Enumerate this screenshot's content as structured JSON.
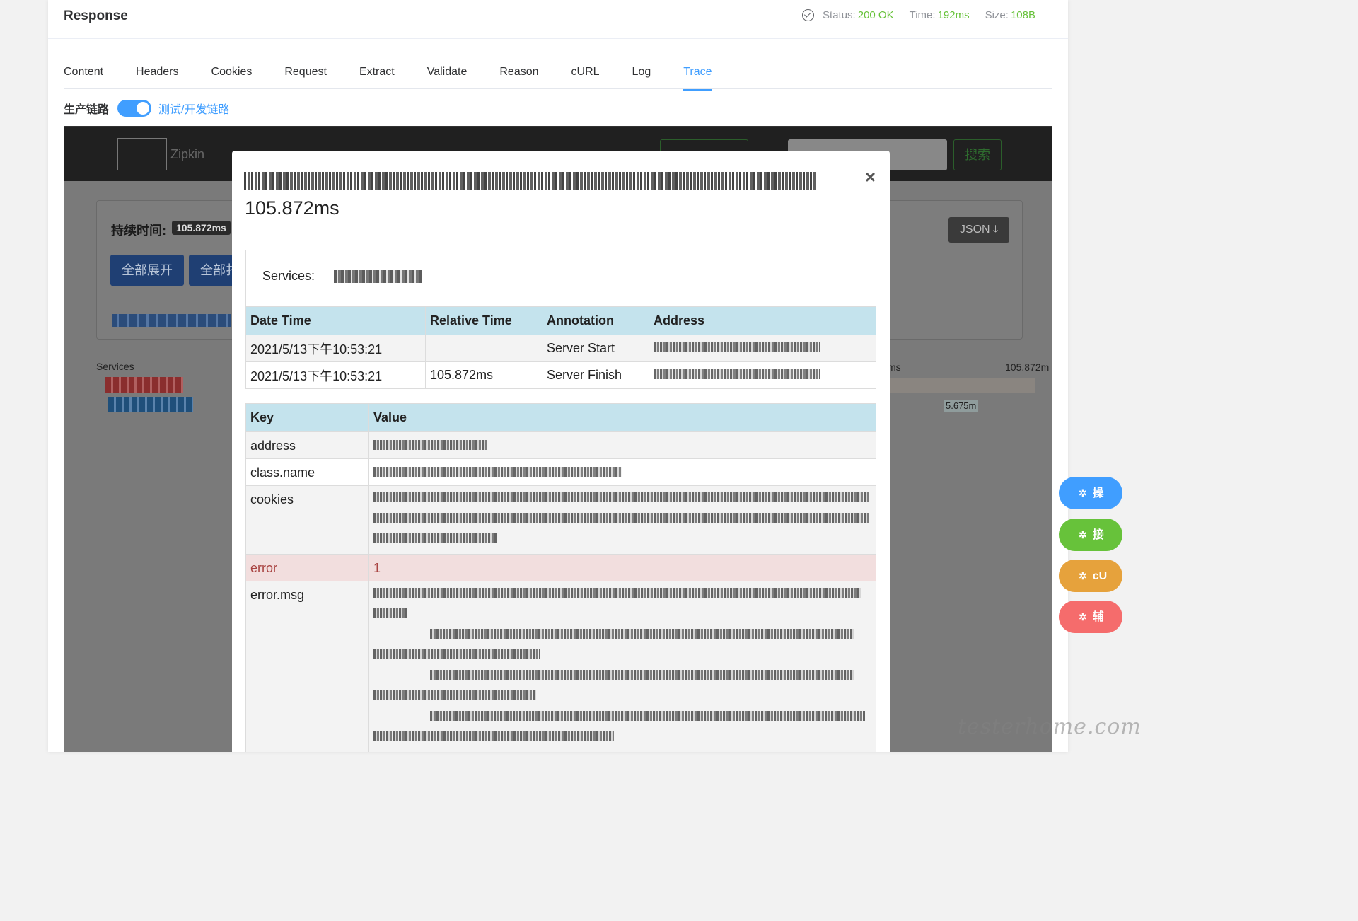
{
  "response": {
    "title": "Response",
    "status_label": "Status:",
    "status_value": "200 OK",
    "time_label": "Time:",
    "time_value": "192ms",
    "size_label": "Size:",
    "size_value": "108B"
  },
  "tabs": [
    "Content",
    "Headers",
    "Cookies",
    "Request",
    "Extract",
    "Validate",
    "Reason",
    "cURL",
    "Log",
    "Trace"
  ],
  "active_tab": "Trace",
  "chain_switch": {
    "left_label": "生产链路",
    "right_label": "测试/开发链路",
    "on": true
  },
  "zipkin": {
    "brand": "Zipkin",
    "search_button": "搜索",
    "duration_label": "持续时间:",
    "duration_value": "105.872ms",
    "expand_all": "全部展开",
    "collapse_all": "全部扌",
    "json_button": "JSON",
    "services_label": "Services",
    "timeline_ms": "ms",
    "timeline_total": "105.872m",
    "span_time": "5.675m"
  },
  "modal": {
    "title_time": "105.872ms",
    "services_label": "Services:",
    "annotation_headers": [
      "Date Time",
      "Relative Time",
      "Annotation",
      "Address"
    ],
    "annotations": [
      {
        "date": "2021/5/13下午10:53:21",
        "relative": "",
        "annotation": "Server Start"
      },
      {
        "date": "2021/5/13下午10:53:21",
        "relative": "105.872ms",
        "annotation": "Server Finish"
      }
    ],
    "tag_headers": [
      "Key",
      "Value"
    ],
    "tags": [
      {
        "key": "address",
        "value": ""
      },
      {
        "key": "class.name",
        "value": ""
      },
      {
        "key": "cookies",
        "value": ""
      },
      {
        "key": "error",
        "value": "1"
      },
      {
        "key": "error.msg",
        "value": ""
      }
    ]
  },
  "side_buttons": [
    {
      "label": "操",
      "color": "#409eff"
    },
    {
      "label": "接",
      "color": "#67c23a"
    },
    {
      "label": "cU",
      "color": "#e6a23c"
    },
    {
      "label": "辅",
      "color": "#f56c6c"
    }
  ],
  "watermark": "testerhome.com"
}
